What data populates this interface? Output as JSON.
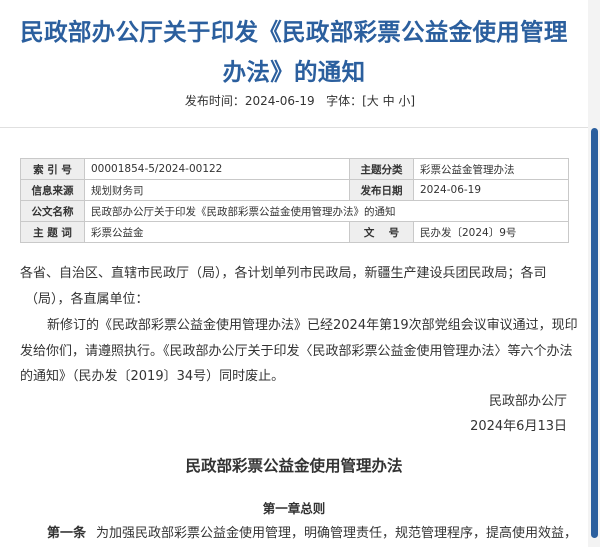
{
  "header": {
    "title_line1": "民政部办公厅关于印发《民政部彩票公益金使用管理",
    "title_line2": "办法》的通知",
    "publish_label": "发布时间：",
    "publish_date": "2024-06-19",
    "font_label": "字体：",
    "font_sizes": "[大 中 小]"
  },
  "info": {
    "index_label": "索 引 号",
    "index_value": "00001854-5/2024-00122",
    "category_label": "主题分类",
    "category_value": "彩票公益金管理办法",
    "source_label": "信息来源",
    "source_value": "规划财务司",
    "date_label": "发布日期",
    "date_value": "2024-06-19",
    "doc_title_label": "公文名称",
    "doc_title_value": "民政部办公厅关于印发《民政部彩票公益金使用管理办法》的通知",
    "keyword_label": "主 题 词",
    "keyword_value": "彩票公益金",
    "docno_label": "文　 号",
    "docno_value": "民办发〔2024〕9号"
  },
  "body": {
    "line1": "各省、自治区、直辖市民政厅（局），各计划单列市民政局，新疆生产建设兵团民政局；各司",
    "line2": "（局），各直属单位：",
    "line3": "新修订的《民政部彩票公益金使用管理办法》已经2024年第19次部党组会议审议通过，现印",
    "line4": "发给你们，请遵照执行。《民政部办公厅关于印发〈民政部彩票公益金使用管理办法〉等六个办法",
    "line5": "的通知》（民办发〔2019〕34号）同时废止。",
    "signature": "民政部办公厅",
    "sign_date": "2024年6月13日"
  },
  "document": {
    "title": "民政部彩票公益金使用管理办法",
    "chapter": "第一章总则",
    "article_no": "第一条",
    "article_text": "为加强民政部彩票公益金使用管理，明确管理责任，规范管理程序，提高使用效益，"
  },
  "colors": {
    "title": "#2b5f9e",
    "scroll_thumb": "#2b5f9e",
    "label_bg": "#eeeeee"
  }
}
